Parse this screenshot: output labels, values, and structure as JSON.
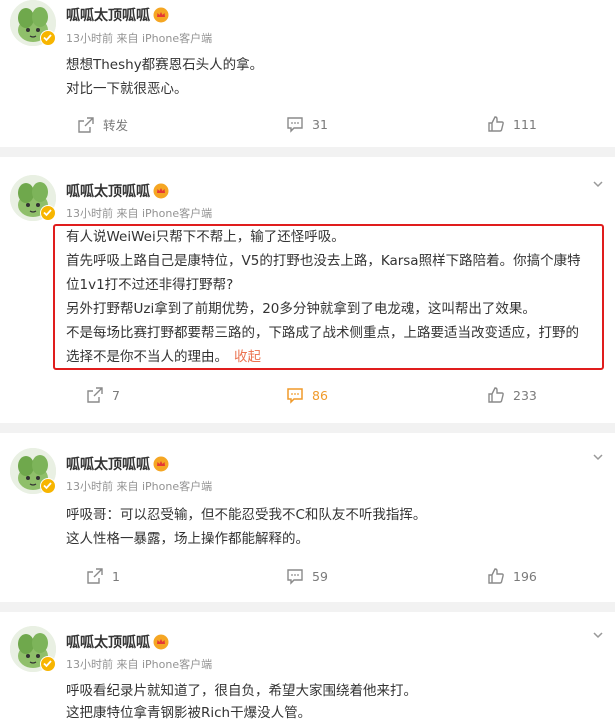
{
  "posts": [
    {
      "author": "呱呱太顶呱呱",
      "meta": "13小时前 来自 iPhone客户端",
      "lines": [
        "想想Theshy都赛恩石头人的拿。",
        "对比一下就很恶心。"
      ],
      "actions": {
        "share": "转发",
        "comment": "31",
        "like": "111"
      }
    },
    {
      "author": "呱呱太顶呱呱",
      "meta": "13小时前 来自 iPhone客户端",
      "lines": [
        "有人说WeiWei只帮下不帮上，输了还怪呼吸。",
        "首先呼吸上路自己是康特位，V5的打野也没去上路，Karsa照样下路陪着。你搞个康特",
        "位1v1打不过还非得打野帮?",
        "另外打野帮Uzi拿到了前期优势，20多分钟就拿到了电龙魂，这叫帮出了效果。",
        "不是每场比赛打野都要帮三路的，下路成了战术侧重点，上路要适当改变适应，打野的",
        "选择不是你不当人的理由。"
      ],
      "collapse": "收起",
      "actions": {
        "share": "7",
        "comment": "86",
        "like": "233"
      }
    },
    {
      "author": "呱呱太顶呱呱",
      "meta": "13小时前 来自 iPhone客户端",
      "lines": [
        "呼吸哥：可以忍受输，但不能忍受我不C和队友不听我指挥。",
        "这人性格一暴露，场上操作都能解释的。"
      ],
      "actions": {
        "share": "1",
        "comment": "59",
        "like": "196"
      }
    },
    {
      "author": "呱呱太顶呱呱",
      "meta": "13小时前 来自 iPhone客户端",
      "lines": [
        "呼吸看纪录片就知道了，很自负，希望大家围绕着他来打。",
        "这把康特位拿青钢影被Rich干爆没人管。"
      ]
    }
  ],
  "colors": {
    "accent": "#eb7350",
    "highlight": "#e01d1d",
    "active": "#f09a2a"
  },
  "icons": [
    "avatar",
    "verified-badge",
    "crown-badge-icon",
    "chevron-down-icon",
    "share-icon",
    "comment-icon",
    "like-icon"
  ]
}
